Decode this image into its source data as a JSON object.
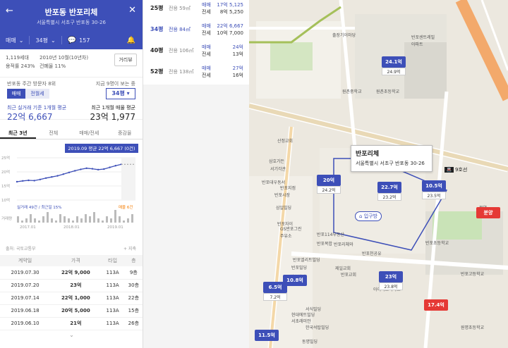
{
  "header": {
    "title": "반포동 반포리체",
    "address": "서울특별시 서초구 반포동 30-26",
    "deal_type": "매매",
    "area_filter": "34평",
    "comments": "157"
  },
  "info": {
    "households": "1,119세대",
    "built": "2010년 10월(10년차)",
    "ratio1": "용적률 243%",
    "ratio2": "건폐율 11%",
    "distance_btn": "거리뷰"
  },
  "trade": {
    "title": "반포동 주간 방문자 8위",
    "tab_sale": "매매",
    "tab_rent": "전월세",
    "right_title": "지금 9명이 보는 중",
    "area_select": "34평",
    "left_label": "최근 실거래 기준 1개월 평균",
    "left_value": "22억 6,667",
    "right_label": "최근 1개월 매물 평균",
    "right_value": "23억 1,977"
  },
  "tabs": [
    "최근 3년",
    "전체",
    "매매/전세",
    "중감율"
  ],
  "chart_data": {
    "type": "line",
    "tooltip": "2019.09 평균 22억 6,667 (0건)",
    "y_ticks": [
      "25억",
      "20억",
      "15억",
      "10억"
    ],
    "x_ticks": [
      "2017.01",
      "2018.01",
      "2019.01"
    ],
    "ylim": [
      10,
      25
    ],
    "legend_left": "실거래 49건 / 최근일 15%",
    "legend_right": "매물 6건",
    "volume_label": "거래량",
    "series": [
      {
        "name": "실거래",
        "values": [
          16.5,
          16.8,
          17.0,
          16.9,
          17.3,
          17.8,
          18.2,
          18.6,
          19.2,
          19.8,
          20.4,
          20.9,
          21.3,
          21.1,
          20.8,
          21.0,
          21.6,
          22.2,
          22.7
        ]
      }
    ]
  },
  "table": {
    "source": "출처: 국토교통부",
    "sort": "+ 지축",
    "headers": [
      "계약일",
      "가격",
      "타입",
      "층"
    ],
    "rows": [
      [
        "2019.07.30",
        "22억 9,000",
        "113A",
        "9층"
      ],
      [
        "2019.07.20",
        "23억",
        "113A",
        "30층"
      ],
      [
        "2019.07.14",
        "22억 1,000",
        "113A",
        "22층"
      ],
      [
        "2019.06.18",
        "20억 5,000",
        "113A",
        "15층"
      ],
      [
        "2019.06.10",
        "21억",
        "113A",
        "26층"
      ]
    ],
    "more": "⌄"
  },
  "area_list": [
    {
      "py": "25평",
      "ex": "전용 59㎡",
      "k1": "매매",
      "k2": "전세",
      "v1": "17억 5,125",
      "v2": "8억 5,250"
    },
    {
      "py": "34평",
      "ex": "전용 84㎡",
      "k1": "매매",
      "k2": "전세",
      "v1": "22억 6,667",
      "v2": "10억 7,000"
    },
    {
      "py": "40평",
      "ex": "전용 106㎡",
      "k1": "매매",
      "k2": "전세",
      "v1": "24억",
      "v2": "13억"
    },
    {
      "py": "52평",
      "ex": "전용 138㎡",
      "k1": "매매",
      "k2": "전세",
      "v1": "27억",
      "v2": "16억"
    }
  ],
  "map": {
    "popup_title": "반포리체",
    "popup_addr": "서울특별시 서초구 반포동 30-26",
    "entrance": "입구방",
    "labels": [
      "출장기이마당",
      "반포센트레빌",
      "아파트",
      "원촌중학교",
      "원촌초등학교",
      "산정교회",
      "반포시장",
      "삼호가든",
      "서기각관",
      "반포지점",
      "반포대우동서",
      "반포자이",
      "삼일빌딩",
      "GS반포그린",
      "주유소",
      "반포114부동산",
      "반포복합",
      "반포리체와",
      "제일교회",
      "반포교회",
      "반포천공유",
      "래미안반포",
      "아이파크아파트",
      "반포고등학교",
      "세화여중",
      "원명초등학교",
      "반포초등학교",
      "서식빌딩",
      "한국석탑빌딩",
      "동명빌딩",
      "현대에트빌딩",
      "서초래미안",
      "반포엘리트빌딩",
      "반포빌딩",
      "삼호빌딩",
      "분양"
    ],
    "stations": [
      "9호선"
    ],
    "markers": [
      {
        "v": "24.1억",
        "s": "24.9억"
      },
      {
        "v": "20억",
        "s": "24.2억"
      },
      {
        "v": "22.7억",
        "s": "23.2억"
      },
      {
        "v": "10.5억",
        "s": "23.5억"
      },
      {
        "v": "6.5억",
        "s": "7.2억"
      },
      {
        "v": "10.8억",
        "s": ""
      },
      {
        "v": "23억",
        "s": "23.8억"
      },
      {
        "v": "17.4억",
        "s": ""
      },
      {
        "v": "11.5억",
        "s": ""
      },
      {
        "v": "분양",
        "s": ""
      }
    ]
  },
  "colors": {
    "primary": "#3d4fb8",
    "price_red": "#e53935",
    "map_bg": "#ece8df"
  }
}
